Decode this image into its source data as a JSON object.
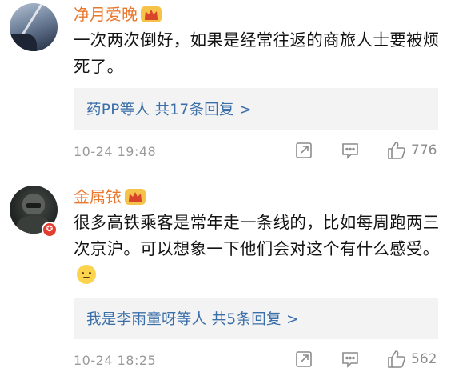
{
  "comments": [
    {
      "username": "净月爱晚",
      "text": "一次两次倒好，如果是经常往返的商旅人士要被烦死了。",
      "replies_label": "药PP等人  共17条回复 >",
      "time": "10-24 19:48",
      "likes": "776",
      "has_vip": true,
      "verified": false
    },
    {
      "username": "金属铱",
      "text": "很多高铁乘客是常年走一条线的，比如每周跑两三次京沪。可以想象一下他们会对这个有什么感受。",
      "replies_label": "我是李雨童呀等人  共5条回复 >",
      "time": "10-24 18:25",
      "likes": "562",
      "has_vip": true,
      "verified": true
    }
  ],
  "icons": {
    "forward": "forward-icon",
    "comment": "comment-icon",
    "like": "like-icon",
    "vip": "vip-crown-icon"
  },
  "colors": {
    "username": "#e8782e",
    "link": "#3b6fa8",
    "meta": "#9a9a9a",
    "reply_bg": "#f3f3f3"
  }
}
